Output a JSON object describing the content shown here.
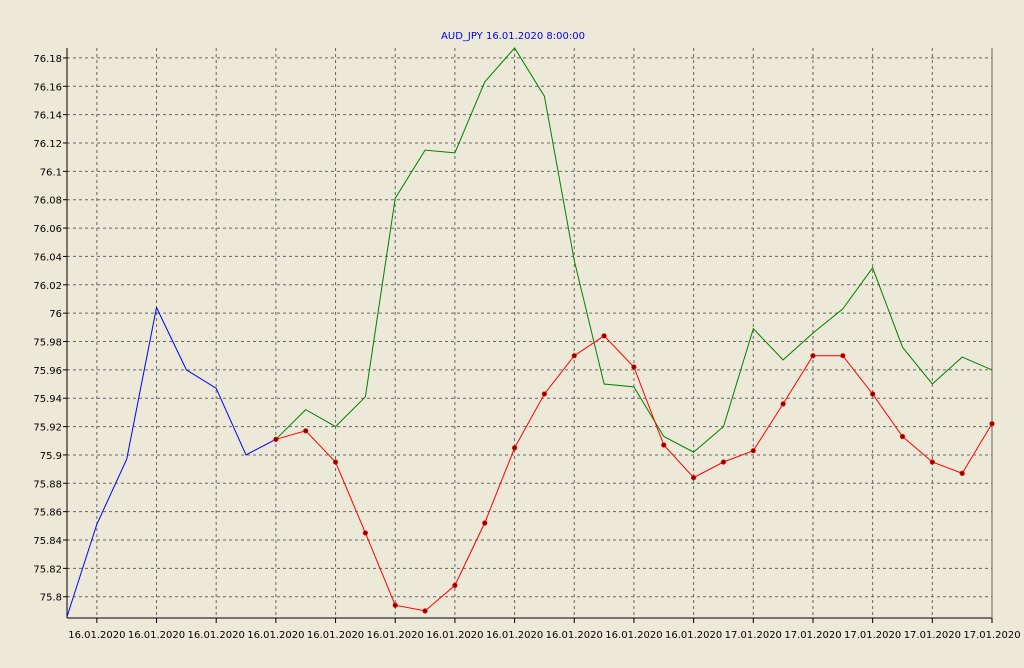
{
  "chart_data": {
    "type": "line",
    "title": "AUD_JPY 16.01.2020 8:00:00",
    "xlabel": "",
    "ylabel": "",
    "ylim": [
      75.785,
      76.187
    ],
    "grid": true,
    "legend": "none",
    "y_ticks": [
      75.8,
      75.82,
      75.84,
      75.86,
      75.88,
      75.9,
      75.92,
      75.94,
      75.96,
      75.98,
      76,
      76.02,
      76.04,
      76.06,
      76.08,
      76.1,
      76.12,
      76.14,
      76.16,
      76.18
    ],
    "y_tick_labels": [
      "75.8",
      "75.82",
      "75.84",
      "75.86",
      "75.88",
      "75.9",
      "75.92",
      "75.94",
      "75.96",
      "75.98",
      "76",
      "76.02",
      "76.04",
      "76.06",
      "76.08",
      "76.1",
      "76.12",
      "76.14",
      "76.16",
      "76.18"
    ],
    "x_ticks": [
      1,
      3,
      5,
      7,
      9,
      11,
      13,
      15,
      17,
      19,
      21,
      23,
      25,
      27,
      29,
      31
    ],
    "x_tick_labels": [
      "16.01.2020",
      "16.01.2020",
      "16.01.2020",
      "16.01.2020",
      "16.01.2020",
      "16.01.2020",
      "16.01.2020",
      "16.01.2020",
      "16.01.2020",
      "16.01.2020",
      "16.01.2020",
      "17.01.2020",
      "17.01.2020",
      "17.01.2020",
      "17.01.2020",
      "17.01.2020"
    ],
    "x_range": [
      0,
      31
    ],
    "series": [
      {
        "color": "#0000ff",
        "markers": false,
        "x": [
          0,
          1,
          2,
          3,
          4,
          5,
          6,
          7
        ],
        "y": [
          75.786,
          75.851,
          75.897,
          76.004,
          75.96,
          75.947,
          75.9,
          75.911
        ]
      },
      {
        "color": "#008000",
        "markers": false,
        "x": [
          7,
          8,
          9,
          10,
          11,
          12,
          13,
          14,
          15,
          16,
          17,
          18,
          19,
          20,
          21,
          22,
          23,
          24,
          25,
          26,
          27,
          28,
          29,
          30,
          31
        ],
        "y": [
          75.911,
          75.932,
          75.92,
          75.941,
          76.081,
          76.115,
          76.113,
          76.163,
          76.187,
          76.153,
          76.037,
          75.95,
          75.948,
          75.913,
          75.902,
          75.92,
          75.989,
          75.967,
          75.986,
          76.003,
          76.032,
          75.976,
          75.95,
          75.969,
          75.96
        ]
      },
      {
        "color": "#ff0000",
        "markers": true,
        "marker_color": "#800000",
        "x": [
          7,
          8,
          9,
          10,
          11,
          12,
          13,
          14,
          15,
          16,
          17,
          18,
          19,
          20,
          21,
          22,
          23,
          24,
          25,
          26,
          27,
          28,
          29,
          30,
          31
        ],
        "y": [
          75.911,
          75.917,
          75.895,
          75.845,
          75.794,
          75.79,
          75.808,
          75.852,
          75.905,
          75.943,
          75.97,
          75.984,
          75.962,
          75.907,
          75.884,
          75.895,
          75.903,
          75.936,
          75.97,
          75.97,
          75.943,
          75.913,
          75.895,
          75.887,
          75.922
        ]
      }
    ]
  },
  "colors": {
    "background": "#ece9d8",
    "plot_background": "#ece9d8",
    "grid": "#666666",
    "axis": "#000000",
    "title": "#0000ff"
  }
}
